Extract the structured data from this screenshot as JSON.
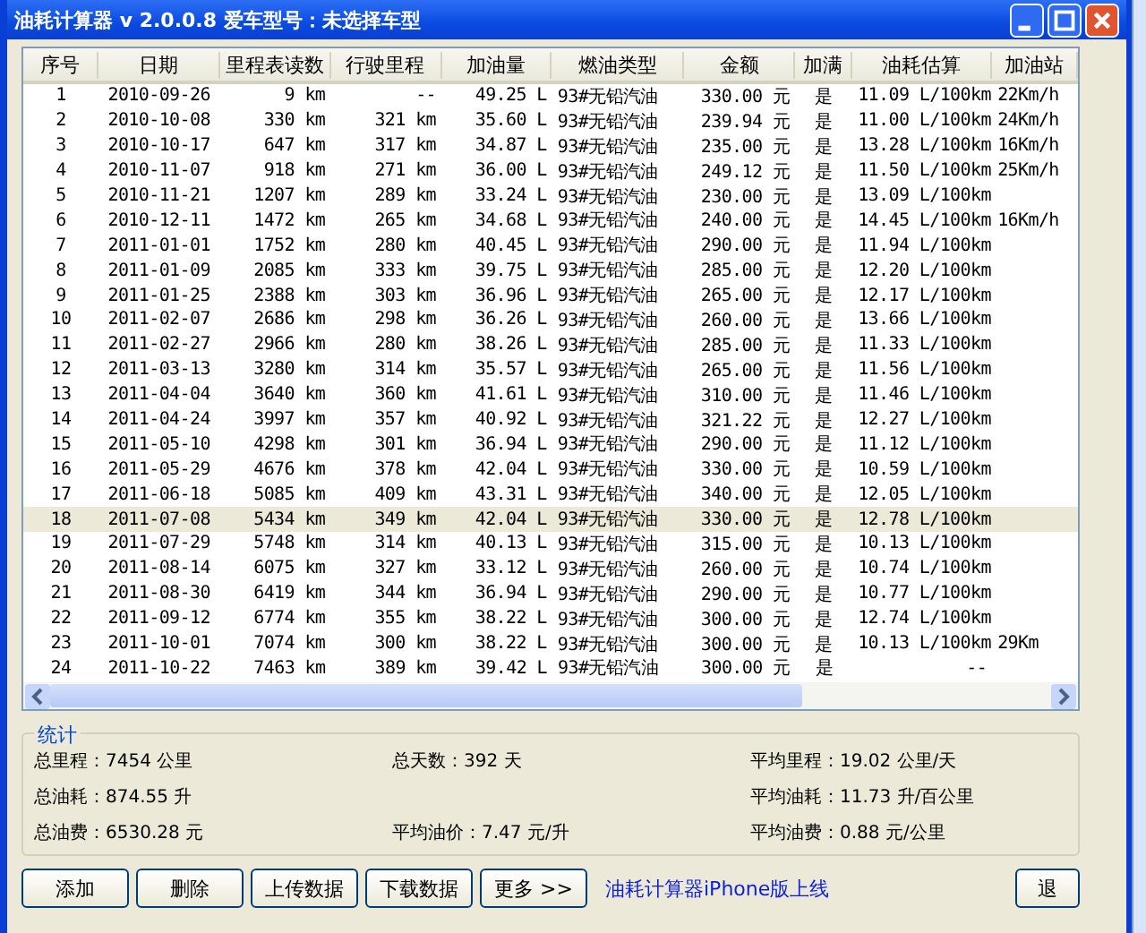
{
  "window": {
    "title": "油耗计算器 v 2.0.0.8  爱车型号：未选择车型"
  },
  "table": {
    "columns": [
      "序号",
      "日期",
      "里程表读数",
      "行驶里程",
      "加油量",
      "燃油类型",
      "金额",
      "加满",
      "油耗估算",
      "加油站"
    ],
    "rows": [
      {
        "selected": false,
        "cells": [
          "1",
          "2010-09-26",
          "9 km",
          "--",
          "49.25 L",
          "93#无铅汽油",
          "330.00 元",
          "是",
          "11.09 L/100km",
          "22Km/h"
        ]
      },
      {
        "selected": false,
        "cells": [
          "2",
          "2010-10-08",
          "330 km",
          "321 km",
          "35.60 L",
          "93#无铅汽油",
          "239.94 元",
          "是",
          "11.00 L/100km",
          "24Km/h"
        ]
      },
      {
        "selected": false,
        "cells": [
          "3",
          "2010-10-17",
          "647 km",
          "317 km",
          "34.87 L",
          "93#无铅汽油",
          "235.00 元",
          "是",
          "13.28 L/100km",
          "16Km/h"
        ]
      },
      {
        "selected": false,
        "cells": [
          "4",
          "2010-11-07",
          "918 km",
          "271 km",
          "36.00 L",
          "93#无铅汽油",
          "249.12 元",
          "是",
          "11.50 L/100km",
          "25Km/h"
        ]
      },
      {
        "selected": false,
        "cells": [
          "5",
          "2010-11-21",
          "1207 km",
          "289 km",
          "33.24 L",
          "93#无铅汽油",
          "230.00 元",
          "是",
          "13.09 L/100km",
          null
        ]
      },
      {
        "selected": false,
        "cells": [
          "6",
          "2010-12-11",
          "1472 km",
          "265 km",
          "34.68 L",
          "93#无铅汽油",
          "240.00 元",
          "是",
          "14.45 L/100km",
          "16Km/h"
        ]
      },
      {
        "selected": false,
        "cells": [
          "7",
          "2011-01-01",
          "1752 km",
          "280 km",
          "40.45 L",
          "93#无铅汽油",
          "290.00 元",
          "是",
          "11.94 L/100km",
          null
        ]
      },
      {
        "selected": false,
        "cells": [
          "8",
          "2011-01-09",
          "2085 km",
          "333 km",
          "39.75 L",
          "93#无铅汽油",
          "285.00 元",
          "是",
          "12.20 L/100km",
          null
        ]
      },
      {
        "selected": false,
        "cells": [
          "9",
          "2011-01-25",
          "2388 km",
          "303 km",
          "36.96 L",
          "93#无铅汽油",
          "265.00 元",
          "是",
          "12.17 L/100km",
          null
        ]
      },
      {
        "selected": false,
        "cells": [
          "10",
          "2011-02-07",
          "2686 km",
          "298 km",
          "36.26 L",
          "93#无铅汽油",
          "260.00 元",
          "是",
          "13.66 L/100km",
          null
        ]
      },
      {
        "selected": false,
        "cells": [
          "11",
          "2011-02-27",
          "2966 km",
          "280 km",
          "38.26 L",
          "93#无铅汽油",
          "285.00 元",
          "是",
          "11.33 L/100km",
          null
        ]
      },
      {
        "selected": false,
        "cells": [
          "12",
          "2011-03-13",
          "3280 km",
          "314 km",
          "35.57 L",
          "93#无铅汽油",
          "265.00 元",
          "是",
          "11.56 L/100km",
          null
        ]
      },
      {
        "selected": false,
        "cells": [
          "13",
          "2011-04-04",
          "3640 km",
          "360 km",
          "41.61 L",
          "93#无铅汽油",
          "310.00 元",
          "是",
          "11.46 L/100km",
          null
        ]
      },
      {
        "selected": false,
        "cells": [
          "14",
          "2011-04-24",
          "3997 km",
          "357 km",
          "40.92 L",
          "93#无铅汽油",
          "321.22 元",
          "是",
          "12.27 L/100km",
          null
        ]
      },
      {
        "selected": false,
        "cells": [
          "15",
          "2011-05-10",
          "4298 km",
          "301 km",
          "36.94 L",
          "93#无铅汽油",
          "290.00 元",
          "是",
          "11.12 L/100km",
          null
        ]
      },
      {
        "selected": false,
        "cells": [
          "16",
          "2011-05-29",
          "4676 km",
          "378 km",
          "42.04 L",
          "93#无铅汽油",
          "330.00 元",
          "是",
          "10.59 L/100km",
          null
        ]
      },
      {
        "selected": false,
        "cells": [
          "17",
          "2011-06-18",
          "5085 km",
          "409 km",
          "43.31 L",
          "93#无铅汽油",
          "340.00 元",
          "是",
          "12.05 L/100km",
          null
        ]
      },
      {
        "selected": true,
        "cells": [
          "18",
          "2011-07-08",
          "5434 km",
          "349 km",
          "42.04 L",
          "93#无铅汽油",
          "330.00 元",
          "是",
          "12.78 L/100km",
          null
        ]
      },
      {
        "selected": false,
        "cells": [
          "19",
          "2011-07-29",
          "5748 km",
          "314 km",
          "40.13 L",
          "93#无铅汽油",
          "315.00 元",
          "是",
          "10.13 L/100km",
          null
        ]
      },
      {
        "selected": false,
        "cells": [
          "20",
          "2011-08-14",
          "6075 km",
          "327 km",
          "33.12 L",
          "93#无铅汽油",
          "260.00 元",
          "是",
          "10.74 L/100km",
          null
        ]
      },
      {
        "selected": false,
        "cells": [
          "21",
          "2011-08-30",
          "6419 km",
          "344 km",
          "36.94 L",
          "93#无铅汽油",
          "290.00 元",
          "是",
          "10.77 L/100km",
          null
        ]
      },
      {
        "selected": false,
        "cells": [
          "22",
          "2011-09-12",
          "6774 km",
          "355 km",
          "38.22 L",
          "93#无铅汽油",
          "300.00 元",
          "是",
          "12.74 L/100km",
          null
        ]
      },
      {
        "selected": false,
        "cells": [
          "23",
          "2011-10-01",
          "7074 km",
          "300 km",
          "38.22 L",
          "93#无铅汽油",
          "300.00 元",
          "是",
          "10.13 L/100km",
          "29Km"
        ]
      },
      {
        "selected": false,
        "cells": [
          "24",
          "2011-10-22",
          "7463 km",
          "389 km",
          "39.42 L",
          "93#无铅汽油",
          "300.00 元",
          "是",
          "--",
          null
        ]
      }
    ]
  },
  "stats": {
    "title": "统计",
    "rows": [
      [
        "总里程：7454 公里",
        "总天数：392 天",
        "平均里程：19.02 公里/天"
      ],
      [
        "总油耗：874.55 升",
        null,
        "平均油耗：11.73 升/百公里"
      ],
      [
        "总油费：6530.28 元",
        "平均油价：7.47 元/升",
        "平均油费：0.88 元/公里"
      ]
    ]
  },
  "buttons": [
    "添加",
    "删除",
    "上传数据",
    "下载数据",
    "更多 >>"
  ],
  "link": "油耗计算器iPhone版上线",
  "exit_button": "退"
}
